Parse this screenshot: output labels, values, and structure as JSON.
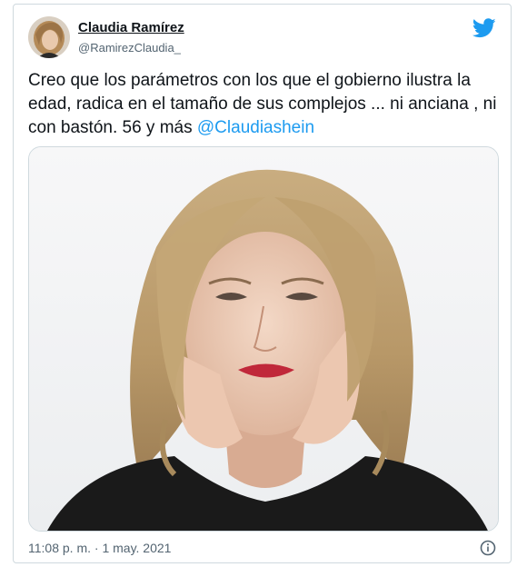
{
  "tweet": {
    "author_name": "Claudia Ramírez",
    "author_handle": "@RamirezClaudia_",
    "text": "Creo que los parámetros con los  que el gobierno ilustra la edad, radica en el tamaño de sus complejos ... ni anciana , ni con bastón. 56 y más ",
    "mention": "@Claudiashein",
    "timestamp": "11:08 p. m. · 1 may. 2021"
  },
  "icons": {
    "brand": "twitter-bird-icon",
    "info": "info-icon"
  },
  "colors": {
    "brand": "#1d9bf0",
    "text": "#0f1419",
    "secondary": "#536471",
    "border": "#cfd9de"
  }
}
